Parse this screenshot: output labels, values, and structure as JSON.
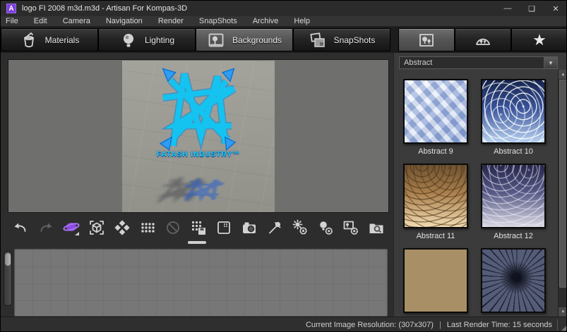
{
  "window": {
    "app_icon_letter": "A",
    "title": "logo FI 2008 m3d.m3d - Artisan For Kompas-3D",
    "controls": {
      "minimize": "—",
      "maximize": "❑",
      "close": "✕"
    }
  },
  "menubar": {
    "items": [
      "File",
      "Edit",
      "Camera",
      "Navigation",
      "Render",
      "SnapShots",
      "Archive",
      "Help"
    ]
  },
  "tabbar": {
    "tabs": [
      {
        "label": "Materials",
        "icon": "paint-bucket-icon",
        "selected": false
      },
      {
        "label": "Lighting",
        "icon": "light-bulb-icon",
        "selected": false
      },
      {
        "label": "Backgrounds",
        "icon": "landscape-image-icon",
        "selected": true
      },
      {
        "label": "SnapShots",
        "icon": "photo-stack-icon",
        "selected": false
      }
    ],
    "mode_buttons": [
      {
        "icon": "background-image-mode-icon",
        "selected": true
      },
      {
        "icon": "panorama-dome-mode-icon",
        "selected": false
      },
      {
        "icon": "favorites-star-icon",
        "selected": false,
        "glyph": "★"
      }
    ]
  },
  "viewport": {
    "logo_text": "FATASH INDUSTRY™"
  },
  "toolbar": {
    "icons": [
      {
        "name": "undo",
        "disabled": false
      },
      {
        "name": "redo",
        "disabled": true
      },
      {
        "name": "render-planet",
        "disabled": false
      },
      {
        "name": "fit-view-cube",
        "disabled": false
      },
      {
        "name": "pattern-diamonds",
        "disabled": false
      },
      {
        "name": "dot-grid",
        "disabled": false
      },
      {
        "name": "disable-ban",
        "disabled": true
      },
      {
        "name": "dot-grid-save",
        "disabled": false
      },
      {
        "name": "frame-grid",
        "disabled": false
      },
      {
        "name": "camera-snapshot",
        "disabled": false
      },
      {
        "name": "eyedropper",
        "disabled": false
      },
      {
        "name": "render-settings-gear",
        "disabled": false
      },
      {
        "name": "light-settings-gear",
        "disabled": false
      },
      {
        "name": "background-settings-gear",
        "disabled": false
      },
      {
        "name": "folder-search",
        "disabled": false
      }
    ]
  },
  "background_panel": {
    "category_value": "Abstract",
    "dropdown_arrow": "▼",
    "scroll_up": "▲",
    "scroll_down": "▼",
    "thumbnails": [
      {
        "label": "Abstract 9",
        "art": "cubes-blue"
      },
      {
        "label": "Abstract 10",
        "art": "rings-blue"
      },
      {
        "label": "Abstract 11",
        "art": "swirl-gold"
      },
      {
        "label": "Abstract 12",
        "art": "swirl-slate"
      },
      {
        "label": "",
        "art": "sand-waves"
      },
      {
        "label": "",
        "art": "shatter-spiral"
      }
    ]
  },
  "statusbar": {
    "resolution": "Current Image Resolution: (307x307)",
    "separator": "|",
    "render_time": "Last Render Time: 15 seconds",
    "resize_grip": "◢"
  }
}
